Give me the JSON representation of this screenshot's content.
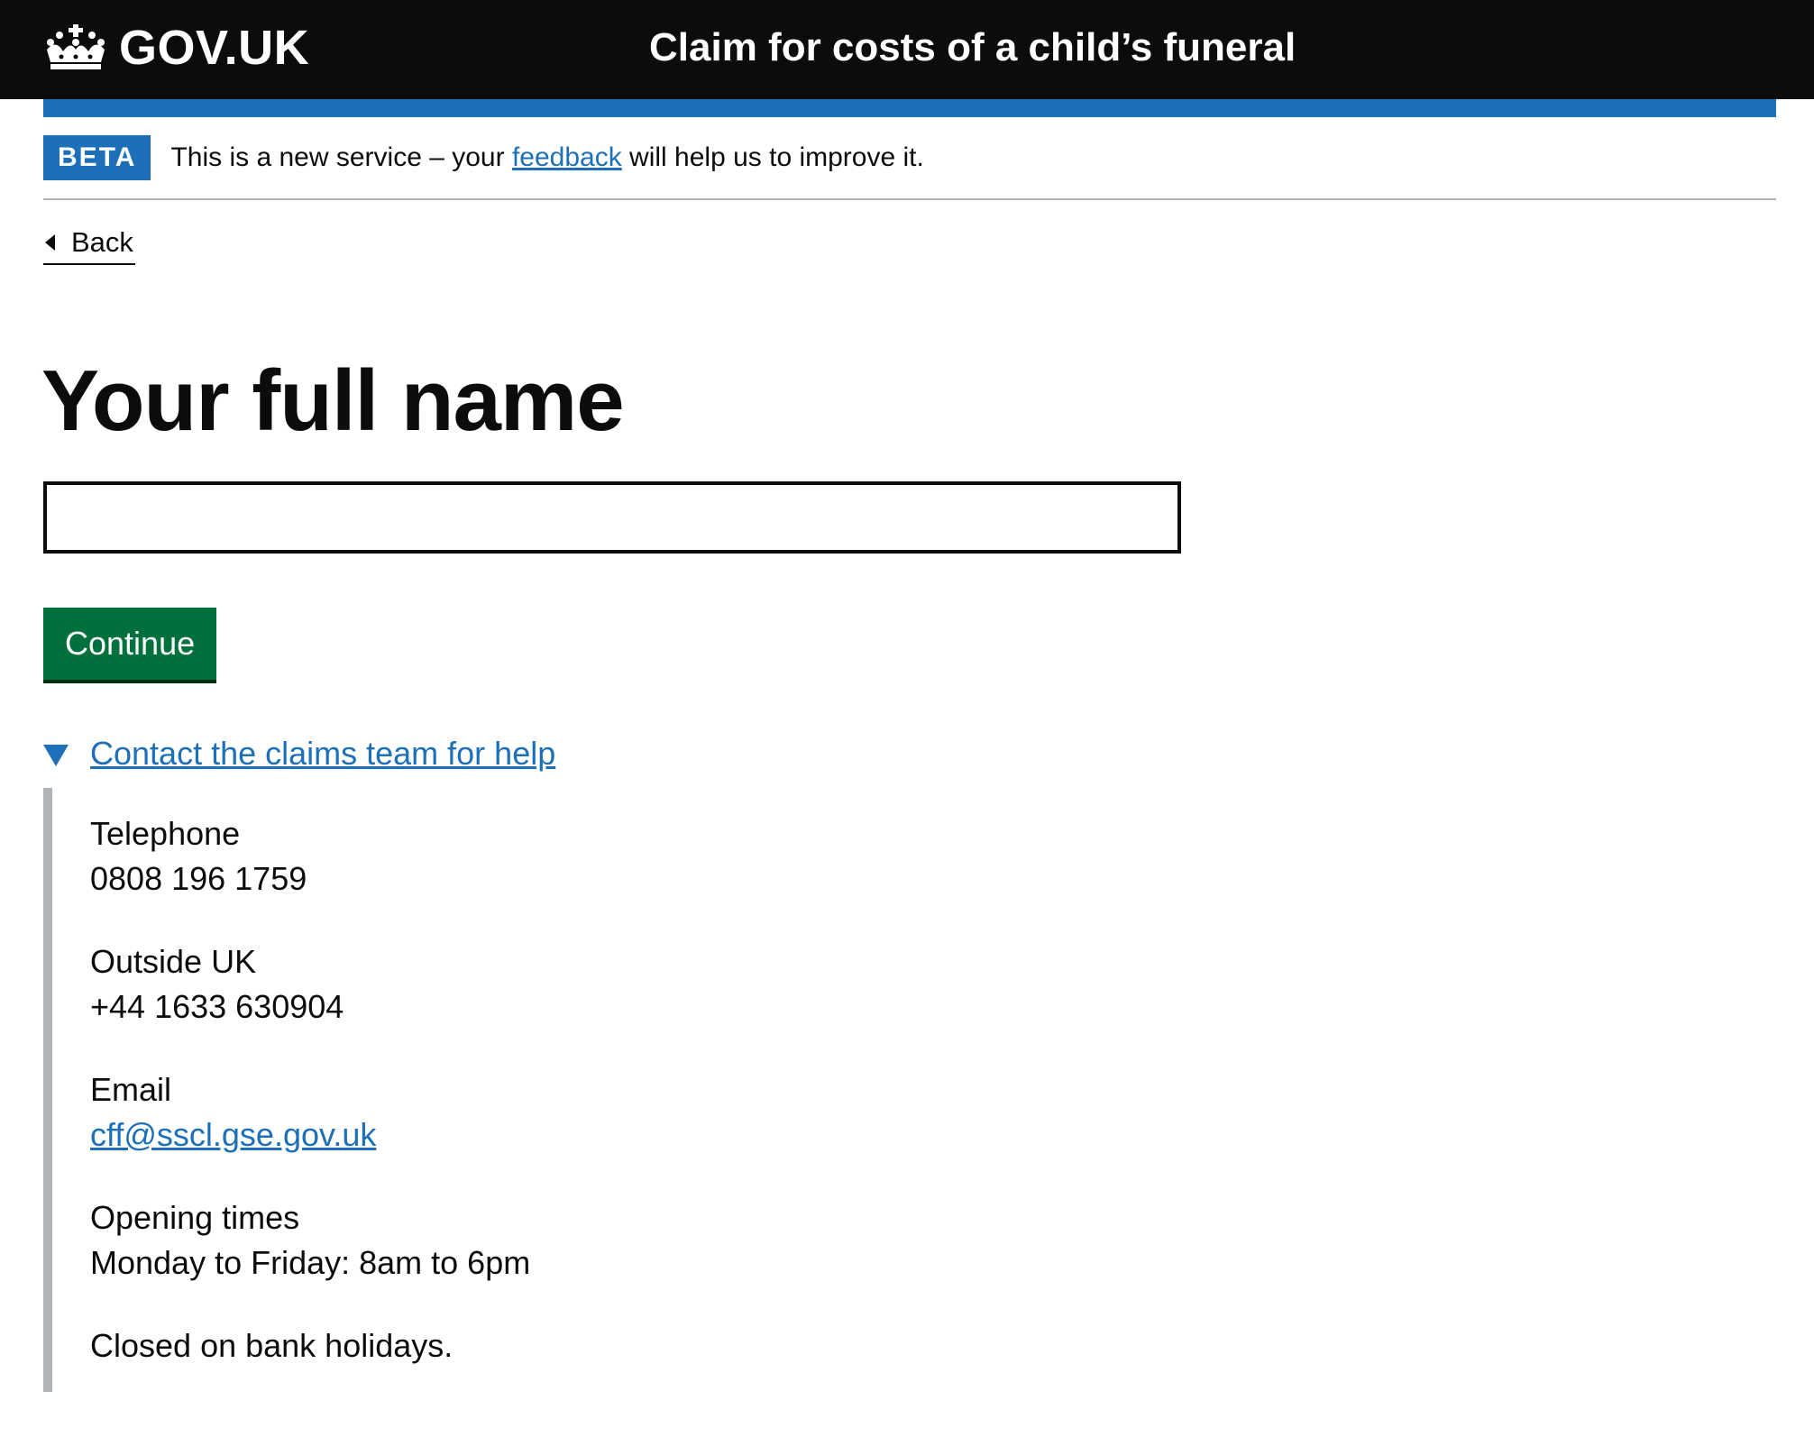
{
  "header": {
    "logo_text": "GOV.UK",
    "service_name": "Claim for costs of a child’s funeral"
  },
  "phase_banner": {
    "tag": "BETA",
    "text_before": "This is a new service – your ",
    "link_text": "feedback",
    "text_after": " will help us to improve it."
  },
  "back_link": {
    "label": "Back"
  },
  "main": {
    "title": "Your full name",
    "name_input": {
      "value": "",
      "placeholder": ""
    },
    "continue_label": "Continue"
  },
  "details": {
    "summary": "Contact the claims team for help",
    "telephone_label": "Telephone",
    "telephone_value": "0808 196 1759",
    "outside_uk_label": "Outside UK",
    "outside_uk_value": "+44 1633 630904",
    "email_label": "Email",
    "email_value": "cff@sscl.gse.gov.uk",
    "opening_label": "Opening times",
    "opening_value": "Monday to Friday: 8am to 6pm",
    "closed_note": "Closed on bank holidays."
  },
  "colors": {
    "header_bg": "#0b0c0c",
    "brand_blue": "#1d70b8",
    "button_green": "#00703c",
    "border_grey": "#b1b4b6"
  },
  "icons": {
    "logo": "crown-icon",
    "back": "back-arrow-icon",
    "details": "triangle-down-icon"
  }
}
